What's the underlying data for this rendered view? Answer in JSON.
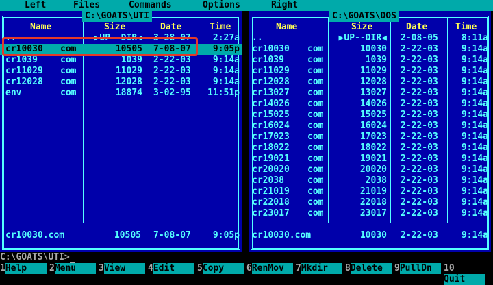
{
  "menu": [
    "Left",
    "Files",
    "Commands",
    "Options",
    "Right"
  ],
  "left_panel": {
    "path": "C:\\GOATS\\UTI",
    "headers": {
      "name": "Name",
      "size": "Size",
      "date": "Date",
      "time": "Time"
    },
    "rows": [
      {
        "name": "..",
        "ext": "",
        "size": "▶UP--DIR◀",
        "date": "3-28-07",
        "time": "2:27a",
        "selected": false
      },
      {
        "name": "cr10030",
        "ext": "com",
        "size": "10505",
        "date": "7-08-07",
        "time": "9:05p",
        "selected": true
      },
      {
        "name": "cr1039",
        "ext": "com",
        "size": "1039",
        "date": "2-22-03",
        "time": "9:14a",
        "selected": false
      },
      {
        "name": "cr11029",
        "ext": "com",
        "size": "11029",
        "date": "2-22-03",
        "time": "9:14a",
        "selected": false
      },
      {
        "name": "cr12028",
        "ext": "com",
        "size": "12028",
        "date": "2-22-03",
        "time": "9:14a",
        "selected": false
      },
      {
        "name": "env",
        "ext": "com",
        "size": "18874",
        "date": "3-02-95",
        "time": "11:51p",
        "selected": false
      }
    ],
    "footer": {
      "name": "cr10030.com",
      "size": "10505",
      "date": "7-08-07",
      "time": "9:05p"
    }
  },
  "right_panel": {
    "path": "C:\\GOATS\\DOS",
    "headers": {
      "name": "Name",
      "size": "Size",
      "date": "Date",
      "time": "Time"
    },
    "rows": [
      {
        "name": "..",
        "ext": "",
        "size": "▶UP--DIR◀",
        "date": "2-08-05",
        "time": "8:11a"
      },
      {
        "name": "cr10030",
        "ext": "com",
        "size": "10030",
        "date": "2-22-03",
        "time": "9:14a"
      },
      {
        "name": "cr1039",
        "ext": "com",
        "size": "1039",
        "date": "2-22-03",
        "time": "9:14a"
      },
      {
        "name": "cr11029",
        "ext": "com",
        "size": "11029",
        "date": "2-22-03",
        "time": "9:14a"
      },
      {
        "name": "cr12028",
        "ext": "com",
        "size": "12028",
        "date": "2-22-03",
        "time": "9:14a"
      },
      {
        "name": "cr13027",
        "ext": "com",
        "size": "13027",
        "date": "2-22-03",
        "time": "9:14a"
      },
      {
        "name": "cr14026",
        "ext": "com",
        "size": "14026",
        "date": "2-22-03",
        "time": "9:14a"
      },
      {
        "name": "cr15025",
        "ext": "com",
        "size": "15025",
        "date": "2-22-03",
        "time": "9:14a"
      },
      {
        "name": "cr16024",
        "ext": "com",
        "size": "16024",
        "date": "2-22-03",
        "time": "9:14a"
      },
      {
        "name": "cr17023",
        "ext": "com",
        "size": "17023",
        "date": "2-22-03",
        "time": "9:14a"
      },
      {
        "name": "cr18022",
        "ext": "com",
        "size": "18022",
        "date": "2-22-03",
        "time": "9:14a"
      },
      {
        "name": "cr19021",
        "ext": "com",
        "size": "19021",
        "date": "2-22-03",
        "time": "9:14a"
      },
      {
        "name": "cr20020",
        "ext": "com",
        "size": "20020",
        "date": "2-22-03",
        "time": "9:14a"
      },
      {
        "name": "cr2038",
        "ext": "com",
        "size": "2038",
        "date": "2-22-03",
        "time": "9:14a"
      },
      {
        "name": "cr21019",
        "ext": "com",
        "size": "21019",
        "date": "2-22-03",
        "time": "9:14a"
      },
      {
        "name": "cr22018",
        "ext": "com",
        "size": "22018",
        "date": "2-22-03",
        "time": "9:14a"
      },
      {
        "name": "cr23017",
        "ext": "com",
        "size": "23017",
        "date": "2-22-03",
        "time": "9:14a"
      }
    ],
    "footer": {
      "name": "cr10030.com",
      "size": "10030",
      "date": "2-22-03",
      "time": "9:14a"
    }
  },
  "prompt": "C:\\GOATS\\UTI>",
  "fkeys": [
    {
      "num": "1",
      "label": "Help"
    },
    {
      "num": "2",
      "label": "Menu"
    },
    {
      "num": "3",
      "label": "View"
    },
    {
      "num": "4",
      "label": "Edit"
    },
    {
      "num": "5",
      "label": "Copy"
    },
    {
      "num": "6",
      "label": "RenMov"
    },
    {
      "num": "7",
      "label": "Mkdir"
    },
    {
      "num": "8",
      "label": "Delete"
    },
    {
      "num": "9",
      "label": "PullDn"
    },
    {
      "num": "10",
      "label": "Quit"
    }
  ],
  "colors": {
    "panel": "#0000aa",
    "text": "#55ffff",
    "header": "#ffff55",
    "bar": "#00aaaa",
    "annotation": "#e23a2a"
  }
}
